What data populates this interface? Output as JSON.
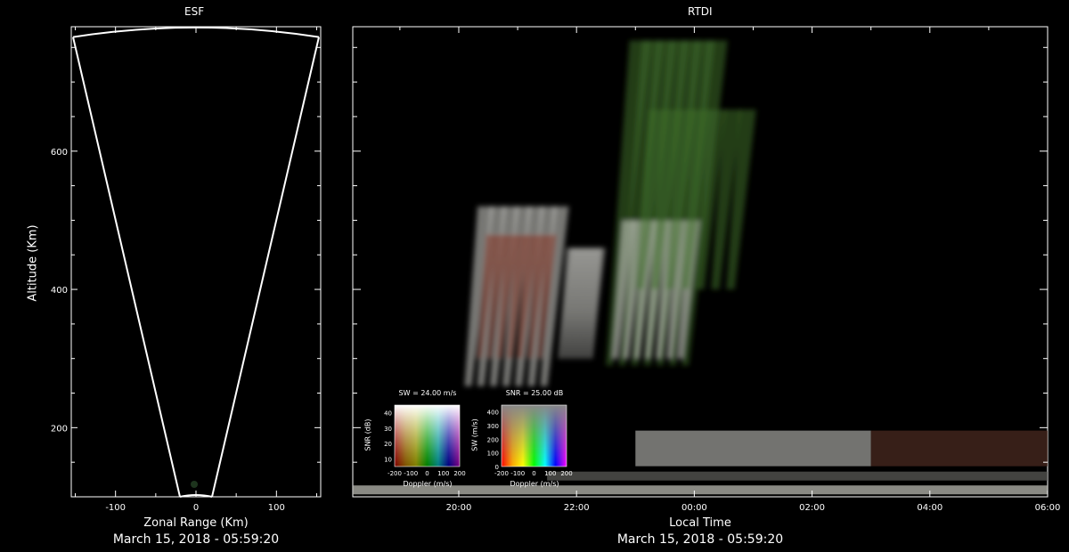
{
  "colors": {
    "background": "#000000",
    "axis": "#ffffff",
    "echo_green": "#3f6e2a",
    "echo_white": "#d8d8d4",
    "echo_red": "#8a3a2a",
    "echo_blue": "#2a3a70",
    "band": "#b8b8b0"
  },
  "esf": {
    "title": "ESF",
    "date": "March 15, 2018 - 05:59:20"
  },
  "rtdi": {
    "title": "RTDI",
    "date": "March 15, 2018 - 05:59:20"
  },
  "chart_data": [
    {
      "type": "scatter",
      "title": "ESF",
      "xlabel": "Zonal Range (Km)",
      "ylabel": "Altitude (Km)",
      "xlim": [
        -155,
        155
      ],
      "ylim": [
        100,
        780
      ],
      "xticks": [
        -100,
        0,
        100
      ],
      "yticks": [
        200,
        400,
        600
      ],
      "fan_boundary": {
        "apex_x": 0,
        "apex_y": 100,
        "outer_x": [
          -155,
          155
        ],
        "outer_y": 765,
        "top_arc_y": 780
      },
      "grid": false
    },
    {
      "type": "heatmap",
      "title": "RTDI",
      "xlabel": "Local Time",
      "xticks": [
        "20:00",
        "22:00",
        "00:00",
        "02:00",
        "04:00",
        "06:00"
      ],
      "xlim_hours": [
        18.2,
        30.0
      ],
      "ylim": [
        100,
        780
      ],
      "echo_plumes": [
        {
          "t_start": 20.1,
          "t_end": 21.6,
          "alt_bottom": 260,
          "alt_top": 520,
          "color": "#d8d8d4"
        },
        {
          "t_start": 20.3,
          "t_end": 21.5,
          "alt_bottom": 300,
          "alt_top": 480,
          "color": "#8a3a2a"
        },
        {
          "t_start": 21.7,
          "t_end": 22.3,
          "alt_bottom": 300,
          "alt_top": 460,
          "color": "#d8d8d4"
        },
        {
          "t_start": 22.5,
          "t_end": 24.0,
          "alt_bottom": 290,
          "alt_top": 760,
          "color": "#3f6e2a"
        },
        {
          "t_start": 22.6,
          "t_end": 23.9,
          "alt_bottom": 300,
          "alt_top": 500,
          "color": "#d8d8d4"
        },
        {
          "t_start": 23.0,
          "t_end": 24.8,
          "alt_bottom": 400,
          "alt_top": 660,
          "color": "#3f6e2a"
        }
      ],
      "bottom_bands": [
        {
          "t_start": 18.2,
          "t_end": 30.0,
          "alt": 110,
          "color": "#b8b8b0"
        },
        {
          "t_start": 21.5,
          "t_end": 30.0,
          "alt": 130,
          "color": "#5a5a55"
        },
        {
          "t_start": 23.0,
          "t_end": 27.0,
          "alt": 170,
          "color": "#9a9a95"
        },
        {
          "t_start": 27.0,
          "t_end": 30.0,
          "alt": 170,
          "color": "#4a2a20"
        }
      ]
    },
    {
      "type": "heatmap",
      "title": "SW = 24.00 m/s",
      "xlabel": "Doppler (m/s)",
      "ylabel": "SNR (dB)",
      "xticks": [
        "-200",
        "-100",
        "0",
        "100",
        "200"
      ],
      "yticks": [
        "10",
        "20",
        "30",
        "40"
      ],
      "xlim": [
        -200,
        200
      ],
      "ylim": [
        5,
        45
      ]
    },
    {
      "type": "heatmap",
      "title": "SNR = 25.00 dB",
      "xlabel": "Doppler (m/s)",
      "ylabel": "SW (m/s)",
      "xticks": [
        "-200",
        "-100",
        "0",
        "100",
        "200"
      ],
      "yticks": [
        "0",
        "100",
        "200",
        "300",
        "400"
      ],
      "xlim": [
        -200,
        200
      ],
      "ylim": [
        0,
        450
      ]
    }
  ]
}
